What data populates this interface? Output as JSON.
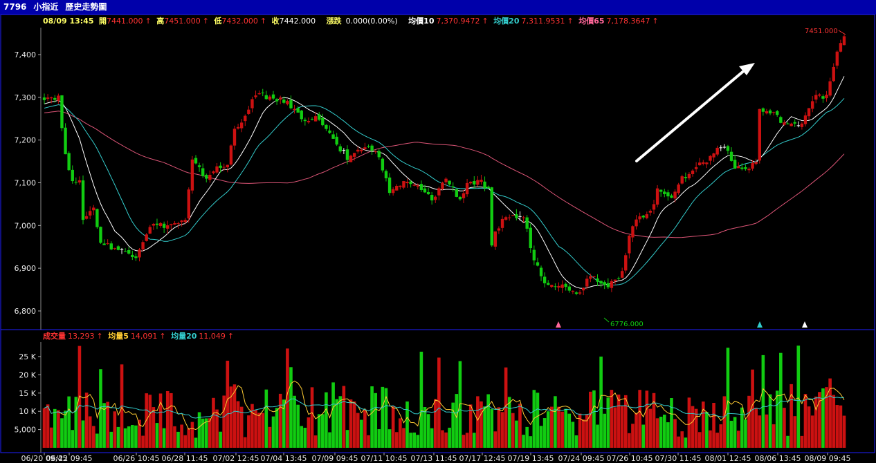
{
  "window": {
    "code": "7796",
    "name": "小指近",
    "title": "歷史走勢圖"
  },
  "price_info": {
    "datetime": "08/09 13:45",
    "open_label": "開",
    "open_value": "7441.000",
    "high_label": "高",
    "high_value": "7451.000",
    "low_label": "低",
    "low_value": "7432.000",
    "close_label": "收",
    "close_value": "7442.000",
    "change_label": "漲跌",
    "change_value": "0.000(0.00%)",
    "ma10_label": "均價10",
    "ma10_value": "7,370.9472",
    "ma20_label": "均價20",
    "ma20_value": "7,311.9531",
    "ma65_label": "均價65",
    "ma65_value": "7,178.3647",
    "up_arrow": "↑"
  },
  "volume_info": {
    "vol_label": "成交量",
    "vol_value": "13,293",
    "ma5_label": "均量5",
    "ma5_value": "14,091",
    "ma20_label": "均量20",
    "ma20_value": "11,049",
    "up_arrow": "↑"
  },
  "annotations": {
    "high_marker": "7451.000",
    "low_marker": "6776.000"
  },
  "colors": {
    "background": "#000000",
    "title_bar": "#0000aa",
    "frame": "#2020ff",
    "up": "#cc1111",
    "down": "#11cc11",
    "flat": "#ffffff",
    "ma10": "#ffffff",
    "ma20": "#33cccc",
    "ma65": "#dd5577",
    "vol_ma5": "#ffcc33",
    "vol_ma20": "#33cccc",
    "label_yellow": "#ffff66",
    "label_red": "#ff3333"
  },
  "chart_data": {
    "type": "candlestick",
    "price_axis": {
      "ticks": [
        "7,400",
        "7,300",
        "7,200",
        "7,100",
        "7,000",
        "6,900",
        "6,800"
      ],
      "tick_values": [
        7400,
        7300,
        7200,
        7100,
        7000,
        6900,
        6800
      ],
      "range": [
        6770,
        7460
      ]
    },
    "volume_axis": {
      "ticks": [
        "25 K",
        "20 K",
        "15 K",
        "10 K",
        "5,000"
      ],
      "tick_values": [
        25000,
        20000,
        15000,
        10000,
        5000
      ],
      "range": [
        0,
        29000
      ]
    },
    "x_ticks": [
      "06/20 09:45",
      "06/22 09:45",
      "06/26 10:45",
      "06/28 11:45",
      "07/02 12:45",
      "07/04 13:45",
      "07/09 09:45",
      "07/11 10:45",
      "07/13 11:45",
      "07/17 12:45",
      "07/19 13:45",
      "07/24 09:45",
      "07/26 10:45",
      "07/30 11:45",
      "08/01 12:45",
      "08/06 13:45",
      "08/09 09:45"
    ],
    "keyframes": [
      [
        0,
        7300
      ],
      [
        4,
        7300
      ],
      [
        6,
        7160
      ],
      [
        8,
        7110
      ],
      [
        10,
        7100
      ],
      [
        11,
        7020
      ],
      [
        14,
        7040
      ],
      [
        16,
        6960
      ],
      [
        22,
        6940
      ],
      [
        26,
        6930
      ],
      [
        30,
        7000
      ],
      [
        35,
        7000
      ],
      [
        40,
        7010
      ],
      [
        42,
        7150
      ],
      [
        46,
        7110
      ],
      [
        48,
        7130
      ],
      [
        52,
        7140
      ],
      [
        54,
        7230
      ],
      [
        57,
        7250
      ],
      [
        60,
        7310
      ],
      [
        64,
        7300
      ],
      [
        68,
        7290
      ],
      [
        70,
        7280
      ],
      [
        73,
        7250
      ],
      [
        78,
        7250
      ],
      [
        82,
        7200
      ],
      [
        86,
        7160
      ],
      [
        90,
        7180
      ],
      [
        94,
        7180
      ],
      [
        98,
        7080
      ],
      [
        102,
        7100
      ],
      [
        106,
        7090
      ],
      [
        110,
        7060
      ],
      [
        114,
        7110
      ],
      [
        118,
        7060
      ],
      [
        120,
        7100
      ],
      [
        124,
        7100
      ],
      [
        126,
        7080
      ],
      [
        127,
        6960
      ],
      [
        130,
        7020
      ],
      [
        136,
        7020
      ],
      [
        139,
        6920
      ],
      [
        142,
        6870
      ],
      [
        146,
        6860
      ],
      [
        150,
        6850
      ],
      [
        152,
        6840
      ],
      [
        154,
        6880
      ],
      [
        156,
        6880
      ],
      [
        160,
        6860
      ],
      [
        164,
        6890
      ],
      [
        166,
        6970
      ],
      [
        168,
        7020
      ],
      [
        172,
        7030
      ],
      [
        174,
        7080
      ],
      [
        178,
        7070
      ],
      [
        181,
        7110
      ],
      [
        185,
        7140
      ],
      [
        188,
        7150
      ],
      [
        191,
        7180
      ],
      [
        193,
        7190
      ],
      [
        196,
        7140
      ],
      [
        199,
        7130
      ],
      [
        202,
        7150
      ],
      [
        203,
        7270
      ],
      [
        207,
        7260
      ],
      [
        210,
        7240
      ],
      [
        214,
        7230
      ],
      [
        216,
        7260
      ],
      [
        219,
        7310
      ],
      [
        222,
        7300
      ],
      [
        224,
        7370
      ],
      [
        226,
        7430
      ],
      [
        227,
        7445
      ]
    ],
    "volume_keyframes": [
      [
        0,
        9000
      ],
      [
        10,
        11000
      ],
      [
        20,
        9000
      ],
      [
        30,
        12000
      ],
      [
        40,
        10000
      ],
      [
        50,
        12000
      ],
      [
        60,
        11000
      ],
      [
        70,
        10000
      ],
      [
        80,
        13000
      ],
      [
        90,
        11000
      ],
      [
        100,
        12000
      ],
      [
        110,
        10000
      ],
      [
        120,
        11000
      ],
      [
        130,
        9000
      ],
      [
        140,
        12000
      ],
      [
        150,
        10000
      ],
      [
        160,
        11000
      ],
      [
        170,
        12000
      ],
      [
        180,
        10000
      ],
      [
        190,
        11000
      ],
      [
        200,
        10000
      ],
      [
        210,
        12000
      ],
      [
        220,
        13000
      ],
      [
        227,
        13293
      ]
    ],
    "high": 7451,
    "low": 6776,
    "signal_markers": [
      {
        "color": "#ff6699",
        "near_label": "07/24 09:45"
      },
      {
        "color": "#33cccc",
        "near_label": "08/06 13:45"
      },
      {
        "color": "#ffffff",
        "near_label": "08/09 09:45"
      }
    ],
    "trend_arrow": "up"
  }
}
